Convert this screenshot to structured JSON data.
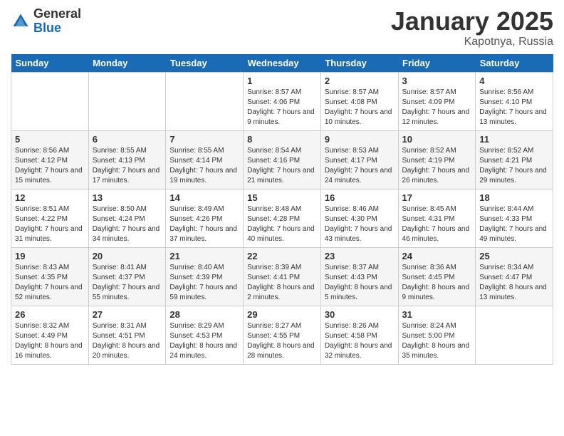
{
  "logo": {
    "general": "General",
    "blue": "Blue"
  },
  "title": "January 2025",
  "location": "Kapotnya, Russia",
  "days_header": [
    "Sunday",
    "Monday",
    "Tuesday",
    "Wednesday",
    "Thursday",
    "Friday",
    "Saturday"
  ],
  "weeks": [
    [
      {
        "day": "",
        "sunrise": "",
        "sunset": "",
        "daylight": ""
      },
      {
        "day": "",
        "sunrise": "",
        "sunset": "",
        "daylight": ""
      },
      {
        "day": "",
        "sunrise": "",
        "sunset": "",
        "daylight": ""
      },
      {
        "day": "1",
        "sunrise": "Sunrise: 8:57 AM",
        "sunset": "Sunset: 4:06 PM",
        "daylight": "Daylight: 7 hours and 9 minutes."
      },
      {
        "day": "2",
        "sunrise": "Sunrise: 8:57 AM",
        "sunset": "Sunset: 4:08 PM",
        "daylight": "Daylight: 7 hours and 10 minutes."
      },
      {
        "day": "3",
        "sunrise": "Sunrise: 8:57 AM",
        "sunset": "Sunset: 4:09 PM",
        "daylight": "Daylight: 7 hours and 12 minutes."
      },
      {
        "day": "4",
        "sunrise": "Sunrise: 8:56 AM",
        "sunset": "Sunset: 4:10 PM",
        "daylight": "Daylight: 7 hours and 13 minutes."
      }
    ],
    [
      {
        "day": "5",
        "sunrise": "Sunrise: 8:56 AM",
        "sunset": "Sunset: 4:12 PM",
        "daylight": "Daylight: 7 hours and 15 minutes."
      },
      {
        "day": "6",
        "sunrise": "Sunrise: 8:55 AM",
        "sunset": "Sunset: 4:13 PM",
        "daylight": "Daylight: 7 hours and 17 minutes."
      },
      {
        "day": "7",
        "sunrise": "Sunrise: 8:55 AM",
        "sunset": "Sunset: 4:14 PM",
        "daylight": "Daylight: 7 hours and 19 minutes."
      },
      {
        "day": "8",
        "sunrise": "Sunrise: 8:54 AM",
        "sunset": "Sunset: 4:16 PM",
        "daylight": "Daylight: 7 hours and 21 minutes."
      },
      {
        "day": "9",
        "sunrise": "Sunrise: 8:53 AM",
        "sunset": "Sunset: 4:17 PM",
        "daylight": "Daylight: 7 hours and 24 minutes."
      },
      {
        "day": "10",
        "sunrise": "Sunrise: 8:52 AM",
        "sunset": "Sunset: 4:19 PM",
        "daylight": "Daylight: 7 hours and 26 minutes."
      },
      {
        "day": "11",
        "sunrise": "Sunrise: 8:52 AM",
        "sunset": "Sunset: 4:21 PM",
        "daylight": "Daylight: 7 hours and 29 minutes."
      }
    ],
    [
      {
        "day": "12",
        "sunrise": "Sunrise: 8:51 AM",
        "sunset": "Sunset: 4:22 PM",
        "daylight": "Daylight: 7 hours and 31 minutes."
      },
      {
        "day": "13",
        "sunrise": "Sunrise: 8:50 AM",
        "sunset": "Sunset: 4:24 PM",
        "daylight": "Daylight: 7 hours and 34 minutes."
      },
      {
        "day": "14",
        "sunrise": "Sunrise: 8:49 AM",
        "sunset": "Sunset: 4:26 PM",
        "daylight": "Daylight: 7 hours and 37 minutes."
      },
      {
        "day": "15",
        "sunrise": "Sunrise: 8:48 AM",
        "sunset": "Sunset: 4:28 PM",
        "daylight": "Daylight: 7 hours and 40 minutes."
      },
      {
        "day": "16",
        "sunrise": "Sunrise: 8:46 AM",
        "sunset": "Sunset: 4:30 PM",
        "daylight": "Daylight: 7 hours and 43 minutes."
      },
      {
        "day": "17",
        "sunrise": "Sunrise: 8:45 AM",
        "sunset": "Sunset: 4:31 PM",
        "daylight": "Daylight: 7 hours and 46 minutes."
      },
      {
        "day": "18",
        "sunrise": "Sunrise: 8:44 AM",
        "sunset": "Sunset: 4:33 PM",
        "daylight": "Daylight: 7 hours and 49 minutes."
      }
    ],
    [
      {
        "day": "19",
        "sunrise": "Sunrise: 8:43 AM",
        "sunset": "Sunset: 4:35 PM",
        "daylight": "Daylight: 7 hours and 52 minutes."
      },
      {
        "day": "20",
        "sunrise": "Sunrise: 8:41 AM",
        "sunset": "Sunset: 4:37 PM",
        "daylight": "Daylight: 7 hours and 55 minutes."
      },
      {
        "day": "21",
        "sunrise": "Sunrise: 8:40 AM",
        "sunset": "Sunset: 4:39 PM",
        "daylight": "Daylight: 7 hours and 59 minutes."
      },
      {
        "day": "22",
        "sunrise": "Sunrise: 8:39 AM",
        "sunset": "Sunset: 4:41 PM",
        "daylight": "Daylight: 8 hours and 2 minutes."
      },
      {
        "day": "23",
        "sunrise": "Sunrise: 8:37 AM",
        "sunset": "Sunset: 4:43 PM",
        "daylight": "Daylight: 8 hours and 5 minutes."
      },
      {
        "day": "24",
        "sunrise": "Sunrise: 8:36 AM",
        "sunset": "Sunset: 4:45 PM",
        "daylight": "Daylight: 8 hours and 9 minutes."
      },
      {
        "day": "25",
        "sunrise": "Sunrise: 8:34 AM",
        "sunset": "Sunset: 4:47 PM",
        "daylight": "Daylight: 8 hours and 13 minutes."
      }
    ],
    [
      {
        "day": "26",
        "sunrise": "Sunrise: 8:32 AM",
        "sunset": "Sunset: 4:49 PM",
        "daylight": "Daylight: 8 hours and 16 minutes."
      },
      {
        "day": "27",
        "sunrise": "Sunrise: 8:31 AM",
        "sunset": "Sunset: 4:51 PM",
        "daylight": "Daylight: 8 hours and 20 minutes."
      },
      {
        "day": "28",
        "sunrise": "Sunrise: 8:29 AM",
        "sunset": "Sunset: 4:53 PM",
        "daylight": "Daylight: 8 hours and 24 minutes."
      },
      {
        "day": "29",
        "sunrise": "Sunrise: 8:27 AM",
        "sunset": "Sunset: 4:55 PM",
        "daylight": "Daylight: 8 hours and 28 minutes."
      },
      {
        "day": "30",
        "sunrise": "Sunrise: 8:26 AM",
        "sunset": "Sunset: 4:58 PM",
        "daylight": "Daylight: 8 hours and 32 minutes."
      },
      {
        "day": "31",
        "sunrise": "Sunrise: 8:24 AM",
        "sunset": "Sunset: 5:00 PM",
        "daylight": "Daylight: 8 hours and 35 minutes."
      },
      {
        "day": "",
        "sunrise": "",
        "sunset": "",
        "daylight": ""
      }
    ]
  ]
}
